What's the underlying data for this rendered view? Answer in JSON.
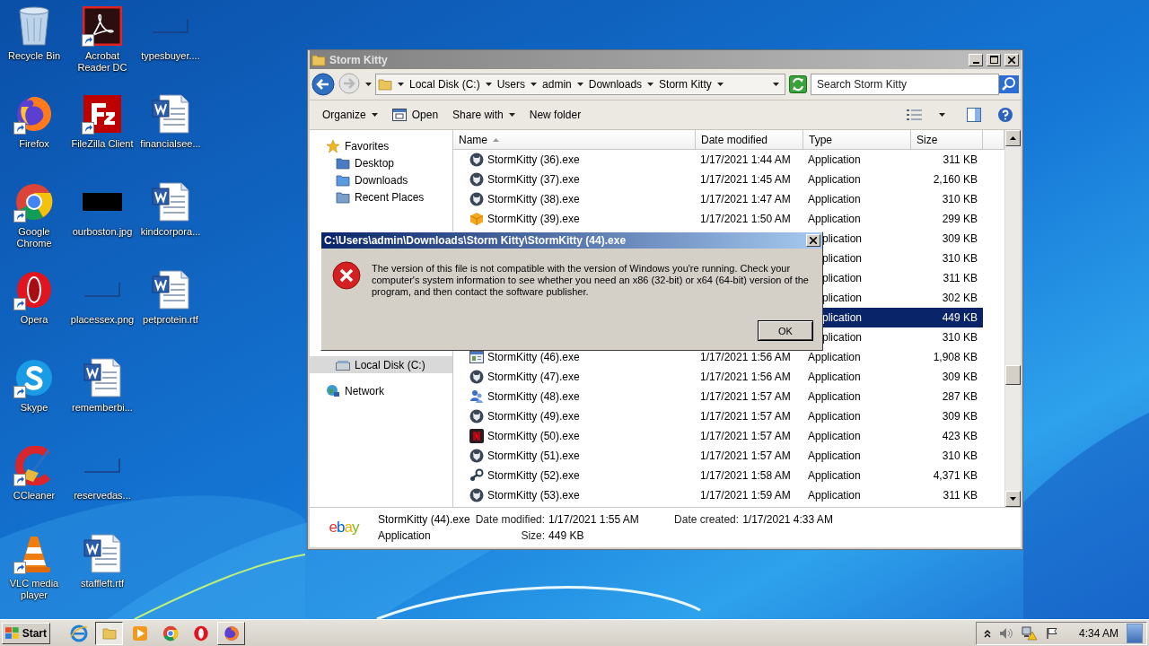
{
  "desktop_icons": [
    {
      "label": "Recycle Bin",
      "shortcut": false
    },
    {
      "label": "Firefox",
      "shortcut": true
    },
    {
      "label": "Google Chrome",
      "shortcut": true
    },
    {
      "label": "Opera",
      "shortcut": true
    },
    {
      "label": "Skype",
      "shortcut": true
    },
    {
      "label": "CCleaner",
      "shortcut": true
    },
    {
      "label": "VLC media player",
      "shortcut": true
    },
    {
      "label": "Acrobat Reader DC",
      "shortcut": true
    },
    {
      "label": "FileZilla Client",
      "shortcut": true
    },
    {
      "label": "ourboston.jpg",
      "shortcut": false
    },
    {
      "label": "placessex.png",
      "shortcut": false
    },
    {
      "label": "rememberbi...",
      "shortcut": false
    },
    {
      "label": "reservedas...",
      "shortcut": false
    },
    {
      "label": "staffleft.rtf",
      "shortcut": false
    },
    {
      "label": "typesbuyer....",
      "shortcut": false
    },
    {
      "label": "financialsee...",
      "shortcut": false
    },
    {
      "label": "kindcorpora...",
      "shortcut": false
    },
    {
      "label": "petprotein.rtf",
      "shortcut": false
    }
  ],
  "explorer": {
    "title": "Storm Kitty",
    "breadcrumb": [
      "Local Disk (C:)",
      "Users",
      "admin",
      "Downloads",
      "Storm Kitty"
    ],
    "search": {
      "placeholder": "Search Storm Kitty"
    },
    "commands": [
      {
        "label": "Organize",
        "kind": "menu"
      },
      {
        "label": "Open",
        "kind": "icon"
      },
      {
        "label": "Share with",
        "kind": "menu"
      },
      {
        "label": "New folder",
        "kind": "plain"
      }
    ],
    "nav": {
      "favorites": {
        "label": "Favorites",
        "items": [
          {
            "label": "Desktop",
            "selected": false
          },
          {
            "label": "Downloads",
            "selected": false
          },
          {
            "label": "Recent Places",
            "selected": false
          }
        ]
      },
      "drives": [
        {
          "label": "Local Disk (C:)",
          "selected": true
        }
      ],
      "network": {
        "label": "Network",
        "selected": false
      }
    },
    "columns": [
      {
        "label": "Name",
        "sorted": true
      },
      {
        "label": "Date modified",
        "sorted": false
      },
      {
        "label": "Type",
        "sorted": false
      },
      {
        "label": "Size",
        "sorted": false
      }
    ],
    "rows": [
      {
        "name": "StormKitty (36).exe",
        "date": "1/17/2021 1:44 AM",
        "type": "Application",
        "size": "311 KB",
        "selected": false,
        "covered": false
      },
      {
        "name": "StormKitty (37).exe",
        "date": "1/17/2021 1:45 AM",
        "type": "Application",
        "size": "2,160 KB",
        "selected": false,
        "covered": false
      },
      {
        "name": "StormKitty (38).exe",
        "date": "1/17/2021 1:47 AM",
        "type": "Application",
        "size": "310 KB",
        "selected": false,
        "covered": false
      },
      {
        "name": "StormKitty (39).exe",
        "date": "1/17/2021 1:50 AM",
        "type": "Application",
        "size": "299 KB",
        "selected": false,
        "covered": false
      },
      {
        "type": "plication",
        "size": "309 KB",
        "selected": false,
        "covered": true
      },
      {
        "type": "plication",
        "size": "310 KB",
        "selected": false,
        "covered": true
      },
      {
        "type": "plication",
        "size": "311 KB",
        "selected": false,
        "covered": true
      },
      {
        "type": "plication",
        "size": "302 KB",
        "selected": false,
        "covered": true
      },
      {
        "type": "plication",
        "size": "449 KB",
        "selected": true,
        "covered": true
      },
      {
        "type": "plication",
        "size": "310 KB",
        "selected": false,
        "covered": true
      },
      {
        "name": "StormKitty (46).exe",
        "date": "1/17/2021 1:56 AM",
        "type": "Application",
        "size": "1,908 KB",
        "selected": false,
        "covered": false
      },
      {
        "name": "StormKitty (47).exe",
        "date": "1/17/2021 1:56 AM",
        "type": "Application",
        "size": "309 KB",
        "selected": false,
        "covered": false
      },
      {
        "name": "StormKitty (48).exe",
        "date": "1/17/2021 1:57 AM",
        "type": "Application",
        "size": "287 KB",
        "selected": false,
        "covered": false
      },
      {
        "name": "StormKitty (49).exe",
        "date": "1/17/2021 1:57 AM",
        "type": "Application",
        "size": "309 KB",
        "selected": false,
        "covered": false
      },
      {
        "name": "StormKitty (50).exe",
        "date": "1/17/2021 1:57 AM",
        "type": "Application",
        "size": "423 KB",
        "selected": false,
        "covered": false
      },
      {
        "name": "StormKitty (51).exe",
        "date": "1/17/2021 1:57 AM",
        "type": "Application",
        "size": "310 KB",
        "selected": false,
        "covered": false
      },
      {
        "name": "StormKitty (52).exe",
        "date": "1/17/2021 1:58 AM",
        "type": "Application",
        "size": "4,371 KB",
        "selected": false,
        "covered": false
      },
      {
        "name": "StormKitty (53).exe",
        "date": "1/17/2021 1:59 AM",
        "type": "Application",
        "size": "311 KB",
        "selected": false,
        "covered": false
      }
    ],
    "details": {
      "icon_label": "ebay",
      "name": "StormKitty (44).exe",
      "type": "Application",
      "fields": [
        {
          "label": "Date modified:",
          "value": "1/17/2021 1:55 AM"
        },
        {
          "label": "Size:",
          "value": "449 KB"
        },
        {
          "label": "Date created:",
          "value": "1/17/2021 4:33 AM"
        }
      ]
    }
  },
  "dialog": {
    "title": "C:\\Users\\admin\\Downloads\\Storm Kitty\\StormKitty (44).exe",
    "message": "The version of this file is not compatible with the version of Windows you're running. Check your computer's system information to see whether you need an x86 (32-bit) or x64 (64-bit) version of the program, and then contact the software publisher.",
    "button": "OK"
  },
  "taskbar": {
    "start": "Start",
    "items": [
      {
        "selected": false,
        "running": false
      },
      {
        "selected": true,
        "running": true
      },
      {
        "selected": false,
        "running": false
      },
      {
        "selected": false,
        "running": false
      },
      {
        "selected": false,
        "running": false
      },
      {
        "selected": false,
        "running": true
      }
    ],
    "clock": "4:34 AM"
  }
}
